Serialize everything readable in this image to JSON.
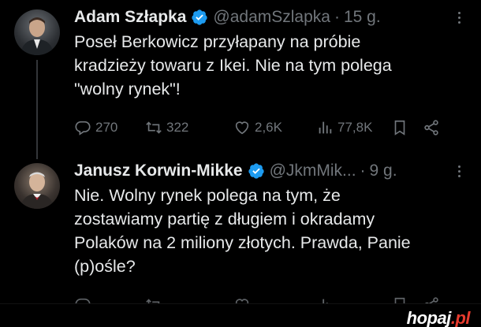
{
  "tweets": [
    {
      "name": "Adam Szłapka",
      "handle": "@adamSzlapka",
      "dot": "·",
      "time": "15 g.",
      "text": "Poseł Berkowicz przyłapany na próbie\nkradzieży towaru z Ikei. Nie na tym polega\n\"wolny rynek\"!",
      "replies": "270",
      "retweets": "322",
      "likes": "2,6K",
      "views": "77,8K"
    },
    {
      "name": "Janusz Korwin-Mikke",
      "handle": "@JkmMik...",
      "dot": "·",
      "time": "9 g.",
      "text": "Nie. Wolny rynek polega na tym, że\nzostawiamy partię z długiem i okradamy\nPolaków na 2 miliony złotych. Prawda, Panie\n(p)ośle?"
    }
  ],
  "watermark": {
    "main": "hopaj",
    "tld": ".pl"
  },
  "colors": {
    "verified": "#1d9bf0",
    "muted": "#71767b",
    "background": "#000000"
  }
}
